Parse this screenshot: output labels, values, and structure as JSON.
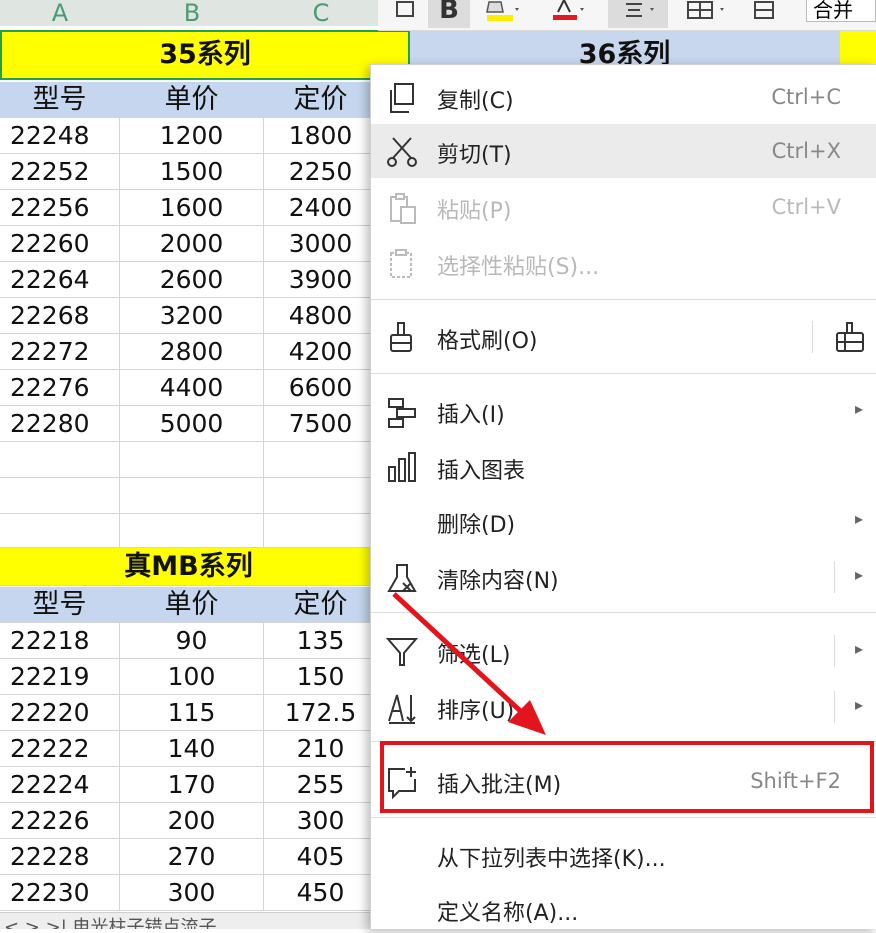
{
  "columns": [
    "A",
    "B",
    "C"
  ],
  "toolbar": {
    "bold": "B",
    "merge": "合并"
  },
  "table1": {
    "title": "35系列",
    "headers": [
      "型号",
      "单价",
      "定价"
    ],
    "rows": [
      [
        "22248",
        "1200",
        "1800"
      ],
      [
        "22252",
        "1500",
        "2250"
      ],
      [
        "22256",
        "1600",
        "2400"
      ],
      [
        "22260",
        "2000",
        "3000"
      ],
      [
        "22264",
        "2600",
        "3900"
      ],
      [
        "22268",
        "3200",
        "4800"
      ],
      [
        "22272",
        "2800",
        "4200"
      ],
      [
        "22276",
        "4400",
        "6600"
      ],
      [
        "22280",
        "5000",
        "7500"
      ]
    ]
  },
  "table2": {
    "title": "36系列"
  },
  "table3": {
    "title": "真MB系列",
    "headers": [
      "型号",
      "单价",
      "定价"
    ],
    "rows": [
      [
        "22218",
        "90",
        "135"
      ],
      [
        "22219",
        "100",
        "150"
      ],
      [
        "22220",
        "115",
        "172.5"
      ],
      [
        "22222",
        "140",
        "210"
      ],
      [
        "22224",
        "170",
        "255"
      ],
      [
        "22226",
        "200",
        "300"
      ],
      [
        "22228",
        "270",
        "405"
      ],
      [
        "22230",
        "300",
        "450"
      ]
    ]
  },
  "sheet_tabs": {
    "text": "< > >|  电光柱子错点流子"
  },
  "menu": {
    "copy": {
      "label": "复制(C)",
      "shortcut": "Ctrl+C"
    },
    "cut": {
      "label": "剪切(T)",
      "shortcut": "Ctrl+X"
    },
    "paste": {
      "label": "粘贴(P)",
      "shortcut": "Ctrl+V"
    },
    "paste_special": {
      "label": "选择性粘贴(S)..."
    },
    "format_painter": {
      "label": "格式刷(O)"
    },
    "insert": {
      "label": "插入(I)"
    },
    "insert_chart": {
      "label": "插入图表"
    },
    "delete": {
      "label": "删除(D)"
    },
    "clear": {
      "label": "清除内容(N)"
    },
    "filter": {
      "label": "筛选(L)"
    },
    "sort": {
      "label": "排序(U)"
    },
    "insert_comment": {
      "label": "插入批注(M)",
      "shortcut": "Shift+F2"
    },
    "pick_list": {
      "label": "从下拉列表中选择(K)..."
    },
    "define_name": {
      "label": "定义名称(A)..."
    }
  },
  "colors": {
    "highlight": "#e3141c",
    "title_yellow": "#ffff00",
    "header_blue": "#c5d6ee"
  }
}
